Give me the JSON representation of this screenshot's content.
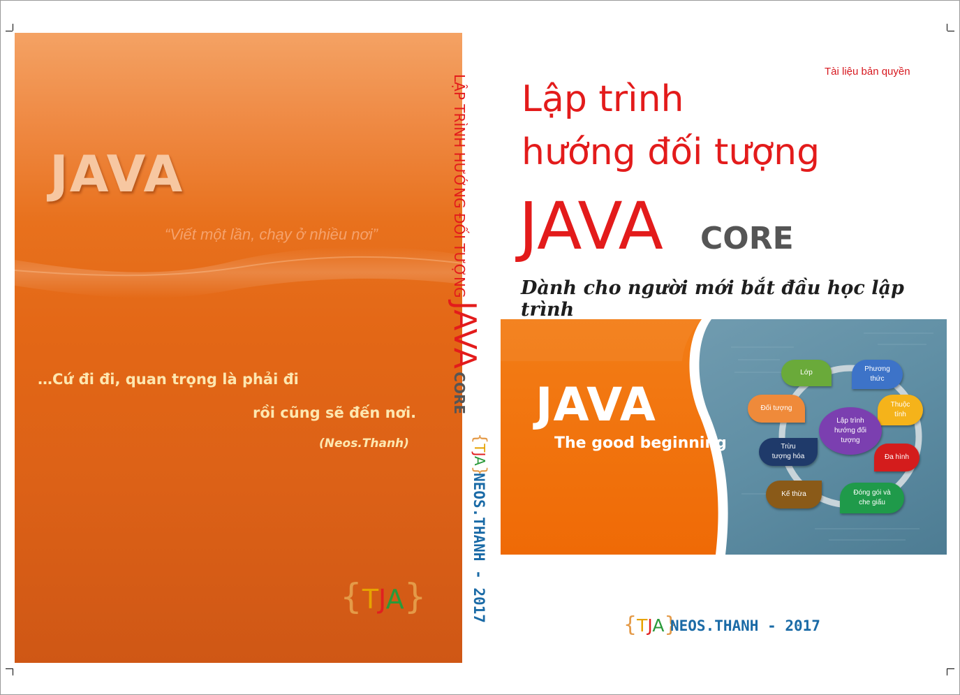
{
  "back_cover": {
    "title": "JAVA",
    "motto": "“Viết một lần, chạy ở nhiều nơi”",
    "quote_line1": "…Cứ đi đi, quan trọng là phải đi",
    "quote_line2": "rồi cũng sẽ đến nơi.",
    "quote_author": "(Neos.Thanh)",
    "logo": {
      "t": "T",
      "j": "J",
      "a": "A",
      "open": "{",
      "close": "}"
    }
  },
  "spine": {
    "title_small": "LẬP TRÌNH HƯỚNG ĐỐI TƯỢNG",
    "title_big": "JAVA",
    "title_core": "CORE",
    "logo": {
      "t": "T",
      "j": "J",
      "a": "A",
      "open": "{",
      "close": "}"
    },
    "author": "NEOS.THANH - 2017"
  },
  "front_cover": {
    "copyright": "Tài liệu bản quyền",
    "title_line1": "Lập trình",
    "title_line2": "hướng đối tượng",
    "title_java": "JAVA",
    "title_core": "CORE",
    "subtitle": "Dành cho người mới bắt đầu học lập trình",
    "banner": {
      "java": "JAVA",
      "tagline": "The good beginning",
      "nodes": {
        "lop": "Lớp",
        "phuong_thuc_1": "Phương",
        "phuong_thuc_2": "thức",
        "thuoc_tinh_1": "Thuộc",
        "thuoc_tinh_2": "tính",
        "doi_tuong": "Đối tượng",
        "center_1": "Lập trình",
        "center_2": "hướng đối",
        "center_3": "tượng",
        "da_hinh": "Đa hình",
        "truu_tuong_1": "Trừu",
        "truu_tuong_2": "tượng hóa",
        "ke_thua": "Kế thừa",
        "dong_goi_1": "Đóng gói và",
        "dong_goi_2": "che giấu"
      }
    },
    "logo": {
      "t": "T",
      "j": "J",
      "a": "A",
      "open": "{",
      "close": "}"
    },
    "author": "NEOS.THANH - 2017"
  },
  "colors": {
    "title_red": "#e31b1b",
    "orange": "#e8711d",
    "author_blue": "#1a6aa6",
    "quote_yellow": "#fde7b0"
  }
}
